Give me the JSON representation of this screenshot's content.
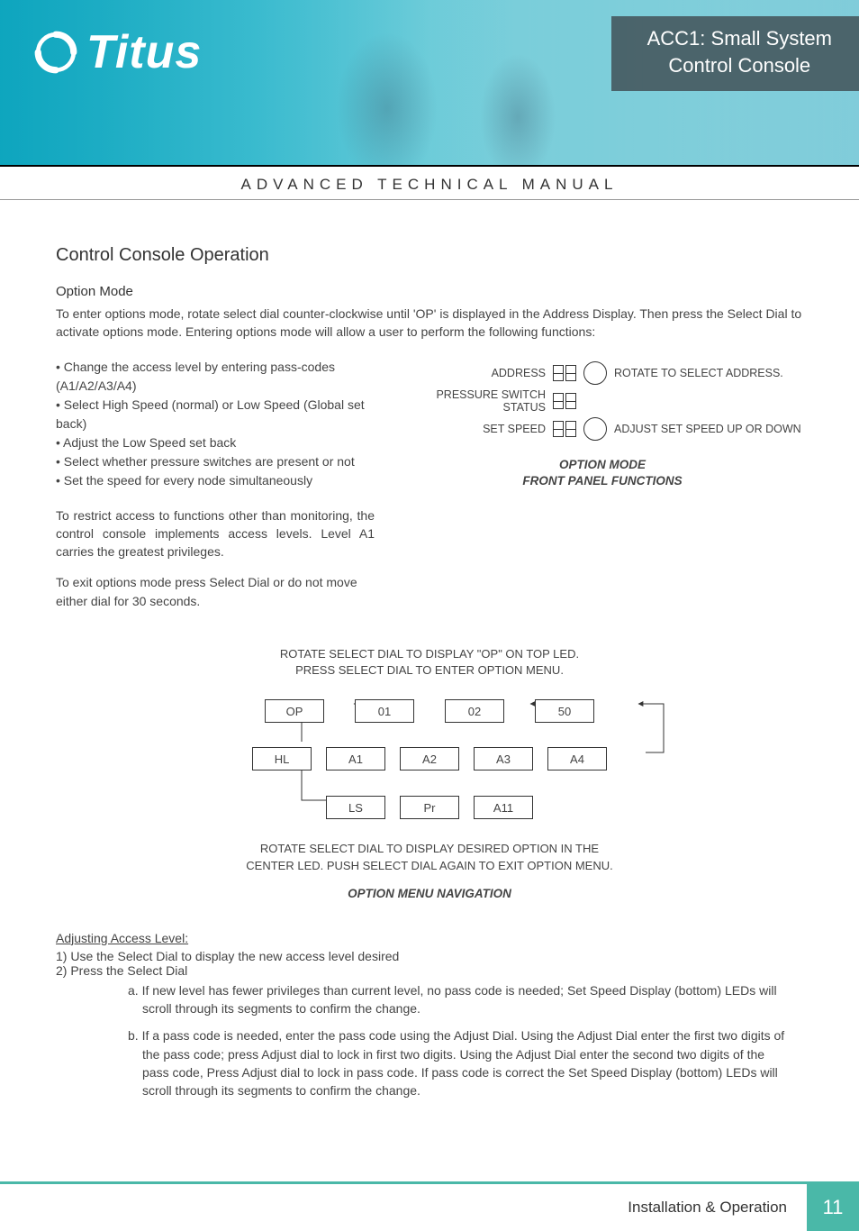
{
  "brand": "Titus",
  "doc_title_line1": "ACC1: Small System",
  "doc_title_line2": "Control Console",
  "manual_bar": "ADVANCED TECHNICAL MANUAL",
  "section": "Control Console Operation",
  "subheading": "Option Mode",
  "intro": "To enter options mode, rotate select dial counter-clockwise until 'OP' is displayed in the Address Display. Then press the Select Dial to activate options mode. Entering options mode will allow a user to perform the following functions:",
  "bullets": [
    "Change the access level by entering pass-codes (A1/A2/A3/A4)",
    "Select High Speed (normal) or Low Speed (Global set back)",
    "Adjust the Low Speed set back",
    "Select whether pressure switches are present or not",
    "Set the speed for every node simultaneously"
  ],
  "para2": "To restrict access to functions other than monitoring, the control console implements access levels. Level A1 carries the greatest privileges.",
  "para3": "To exit options mode press Select Dial or do not move either dial for 30 seconds.",
  "panel": {
    "row1_left": "ADDRESS",
    "row1_right": "ROTATE TO SELECT ADDRESS.",
    "row2_left": "PRESSURE SWITCH STATUS",
    "row3_left": "SET SPEED",
    "row3_right": "ADJUST SET SPEED UP OR DOWN",
    "title_l1": "OPTION MODE",
    "title_l2": "FRONT PANEL FUNCTIONS"
  },
  "menu": {
    "hint_l1": "ROTATE SELECT DIAL TO DISPLAY \"OP\" ON TOP LED.",
    "hint_l2": "PRESS SELECT DIAL TO ENTER OPTION MENU.",
    "row1": [
      "OP",
      "01",
      "02",
      "50"
    ],
    "row2": [
      "HL",
      "A1",
      "A2",
      "A3",
      "A4"
    ],
    "row3": [
      "LS",
      "Pr",
      "A11"
    ],
    "caption_l1": "ROTATE SELECT DIAL TO DISPLAY DESIRED OPTION IN THE",
    "caption_l2": "CENTER LED. PUSH SELECT DIAL AGAIN TO EXIT OPTION MENU.",
    "title": "OPTION MENU NAVIGATION"
  },
  "access": {
    "heading": "Adjusting Access Level:",
    "step1": "1) Use the Select Dial to display the new access level desired",
    "step2": "2) Press the Select Dial",
    "sub_a": "a. If new level has fewer privileges than current level, no pass code is needed; Set Speed Display (bottom) LEDs will scroll through its segments to confirm the change.",
    "sub_b": "b. If a pass code is needed, enter the pass code using the Adjust Dial. Using the Adjust Dial enter the first two digits of the pass code; press Adjust dial to lock in first two digits. Using the Adjust Dial enter the second two digits of the pass code, Press Adjust dial to lock in pass code. If pass code is correct the Set Speed Display (bottom) LEDs will scroll through its segments to confirm the change."
  },
  "footer_label": "Installation & Operation",
  "page_number": "11"
}
